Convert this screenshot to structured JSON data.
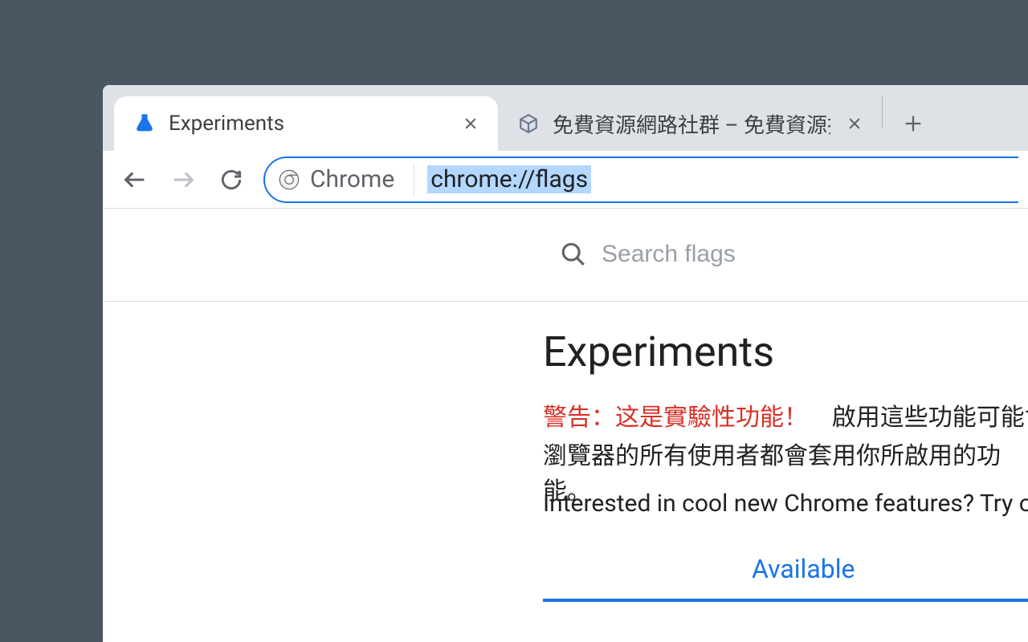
{
  "tabs": [
    {
      "title": "Experiments",
      "favicon_color": "#1a73e8"
    },
    {
      "title": "免費資源網路社群 – 免費資源指南",
      "favicon_box": true
    }
  ],
  "address_bar": {
    "scheme_label": "Chrome",
    "url": "chrome://flags"
  },
  "search": {
    "placeholder": "Search flags"
  },
  "page": {
    "title": "Experiments",
    "warning_label": "警告：这是實驗性功能！",
    "warning_body_part1": "啟用這些功能可能會造",
    "warning_body_line2": "瀏覽器的所有使用者都會套用你所啟用的功能。",
    "interested": "Interested in cool new Chrome features? Try our ",
    "tab_available": "Available"
  }
}
